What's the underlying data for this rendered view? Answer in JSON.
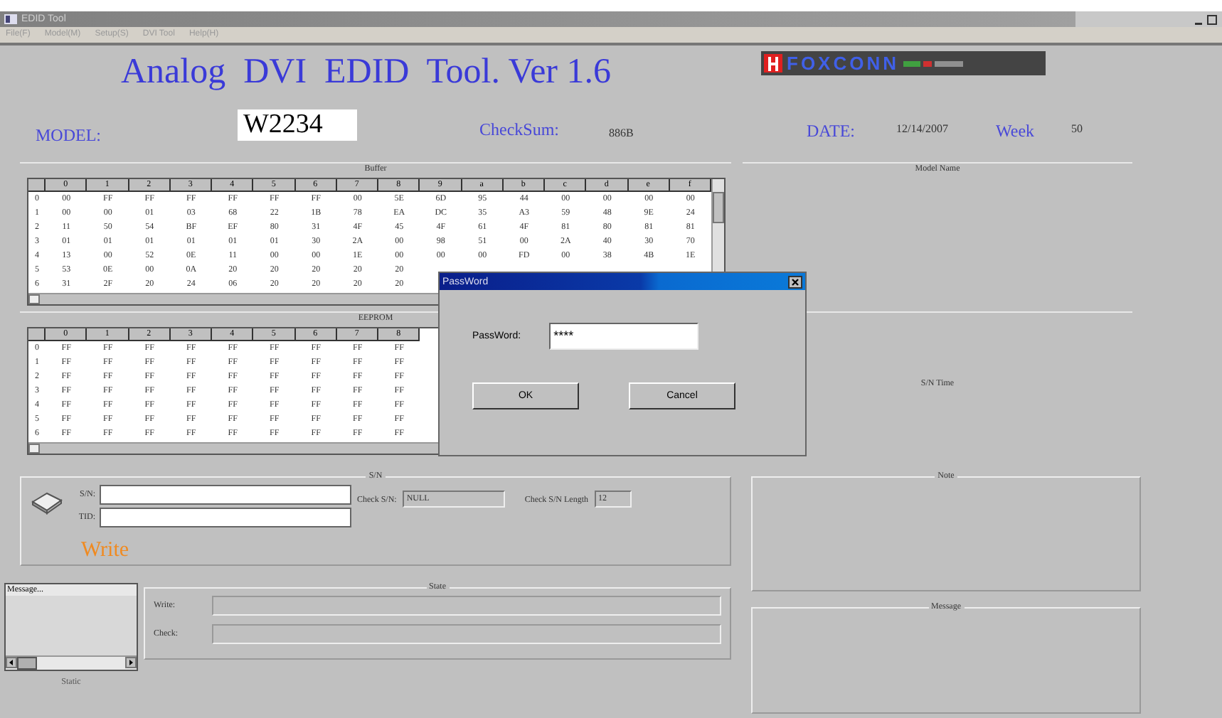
{
  "window": {
    "title": "EDID Tool"
  },
  "menu": [
    "File(F)",
    "Model(M)",
    "Setup(S)",
    "DVI Tool",
    "Help(H)"
  ],
  "header": {
    "title": "Analog  DVI  EDID  Tool. Ver 1.6",
    "logo": "FOXCONN",
    "model_label": "MODEL:",
    "model_value": "W2234",
    "checksum_label": "CheckSum:",
    "checksum_value": "886B",
    "date_label": "DATE:",
    "date_value": "12/14/2007",
    "week_label": "Week",
    "week_value": "50"
  },
  "buffer": {
    "title": "Buffer",
    "columns": [
      "0",
      "1",
      "2",
      "3",
      "4",
      "5",
      "6",
      "7",
      "8",
      "9",
      "a",
      "b",
      "c",
      "d",
      "e",
      "f"
    ],
    "rows": [
      {
        "label": "0",
        "cells": [
          "00",
          "FF",
          "FF",
          "FF",
          "FF",
          "FF",
          "FF",
          "00",
          "5E",
          "6D",
          "95",
          "44",
          "00",
          "00",
          "00",
          "00"
        ]
      },
      {
        "label": "1",
        "cells": [
          "00",
          "00",
          "01",
          "03",
          "68",
          "22",
          "1B",
          "78",
          "EA",
          "DC",
          "35",
          "A3",
          "59",
          "48",
          "9E",
          "24"
        ]
      },
      {
        "label": "2",
        "cells": [
          "11",
          "50",
          "54",
          "BF",
          "EF",
          "80",
          "31",
          "4F",
          "45",
          "4F",
          "61",
          "4F",
          "81",
          "80",
          "81",
          "81"
        ]
      },
      {
        "label": "3",
        "cells": [
          "01",
          "01",
          "01",
          "01",
          "01",
          "01",
          "30",
          "2A",
          "00",
          "98",
          "51",
          "00",
          "2A",
          "40",
          "30",
          "70"
        ]
      },
      {
        "label": "4",
        "cells": [
          "13",
          "00",
          "52",
          "0E",
          "11",
          "00",
          "00",
          "1E",
          "00",
          "00",
          "00",
          "FD",
          "00",
          "38",
          "4B",
          "1E"
        ]
      },
      {
        "label": "5",
        "cells": [
          "53",
          "0E",
          "00",
          "0A",
          "20",
          "20",
          "20",
          "20",
          "20"
        ]
      },
      {
        "label": "6",
        "cells": [
          "31",
          "2F",
          "20",
          "24",
          "06",
          "20",
          "20",
          "20",
          "20"
        ]
      }
    ]
  },
  "eeprom": {
    "title": "EEPROM",
    "columns": [
      "0",
      "1",
      "2",
      "3",
      "4",
      "5",
      "6",
      "7",
      "8"
    ],
    "rows": [
      {
        "label": "0",
        "cells": [
          "FF",
          "FF",
          "FF",
          "FF",
          "FF",
          "FF",
          "FF",
          "FF",
          "FF"
        ]
      },
      {
        "label": "1",
        "cells": [
          "FF",
          "FF",
          "FF",
          "FF",
          "FF",
          "FF",
          "FF",
          "FF",
          "FF"
        ]
      },
      {
        "label": "2",
        "cells": [
          "FF",
          "FF",
          "FF",
          "FF",
          "FF",
          "FF",
          "FF",
          "FF",
          "FF"
        ]
      },
      {
        "label": "3",
        "cells": [
          "FF",
          "FF",
          "FF",
          "FF",
          "FF",
          "FF",
          "FF",
          "FF",
          "FF"
        ]
      },
      {
        "label": "4",
        "cells": [
          "FF",
          "FF",
          "FF",
          "FF",
          "FF",
          "FF",
          "FF",
          "FF",
          "FF"
        ]
      },
      {
        "label": "5",
        "cells": [
          "FF",
          "FF",
          "FF",
          "FF",
          "FF",
          "FF",
          "FF",
          "FF",
          "FF"
        ]
      },
      {
        "label": "6",
        "cells": [
          "FF",
          "FF",
          "FF",
          "FF",
          "FF",
          "FF",
          "FF",
          "FF",
          "FF"
        ]
      }
    ]
  },
  "right_panel": {
    "model_name_label": "Model Name",
    "sn_time_label": "S/N Time"
  },
  "sn_group": {
    "title": "S/N",
    "sn_label": "S/N:",
    "tid_label": "TID:",
    "write_label": "Write",
    "check_sn_label": "Check S/N:",
    "check_sn_value": "NULL",
    "check_len_label": "Check S/N Length",
    "check_len_value": "12"
  },
  "message_list": {
    "items": [
      "Message..."
    ],
    "static_label": "Static"
  },
  "state": {
    "title": "State",
    "write_label": "Write:",
    "check_label": "Check:"
  },
  "note": {
    "title": "Note"
  },
  "message": {
    "title": "Message"
  },
  "dialog": {
    "title": "PassWord",
    "label": "PassWord:",
    "value": "****",
    "buttons": [
      "OK",
      "Cancel"
    ]
  }
}
